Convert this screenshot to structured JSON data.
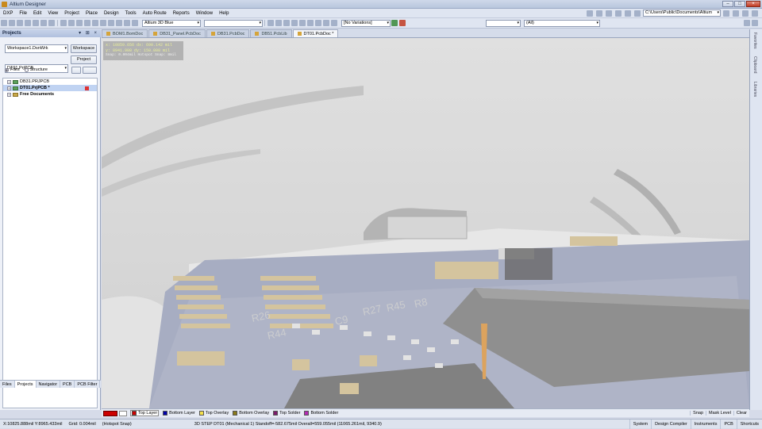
{
  "title": "Altium Designer",
  "menu": [
    "DXP",
    "File",
    "Edit",
    "View",
    "Project",
    "Place",
    "Design",
    "Tools",
    "Auto Route",
    "Reports",
    "Window",
    "Help"
  ],
  "toolbar": {
    "view_config": "Altium 3D Blue",
    "variations": "[No Variations]",
    "path": "C:\\Users\\Public\\Documents\\Altium",
    "filter": "(All)"
  },
  "panel": {
    "title": "Projects",
    "controls": "▾ ⊞ ×",
    "workspace_value": "Workspace1.DsnWrk",
    "workspace_button": "Workspace",
    "project_value": "DT01.PrjPCB",
    "project_button": "Project",
    "radio_files": "Files",
    "radio_structure": "Structure",
    "tree": [
      {
        "label": "DB31.PRJPCB",
        "icon": "project-icon",
        "selected": false
      },
      {
        "label": "DT01.PrjPCB *",
        "icon": "project-icon",
        "selected": true
      },
      {
        "label": "Free Documents",
        "icon": "folder-icon",
        "selected": false
      }
    ],
    "tabs": [
      "Files",
      "Projects",
      "Navigator",
      "PCB",
      "PCB Filter"
    ],
    "active_tab": "Projects"
  },
  "doc_tabs": [
    {
      "label": "BOM1.BomDoc",
      "active": false
    },
    {
      "label": "DB31_Panel.PcbDoc",
      "active": false
    },
    {
      "label": "DB31.PcbDoc",
      "active": false
    },
    {
      "label": "DB51.PcbLib",
      "active": false
    },
    {
      "label": "DT01.PcbDoc *",
      "active": true
    }
  ],
  "coords": {
    "line1": "x: 10859.656   dx: 690.142 mil",
    "line2": "y:  8941.900   dy:  150.000 mil",
    "snap": "Snap: 0.004mil Hotspot Snap: 8mil"
  },
  "right_tabs": [
    "Favorites",
    "Clipboard",
    "Libraries"
  ],
  "pcb_labels": [
    "R26",
    "R44",
    "C9",
    "R27",
    "R45",
    "R8"
  ],
  "layers": [
    {
      "name": "Top Layer",
      "color": "#cc0000",
      "active": true
    },
    {
      "name": "Bottom Layer",
      "color": "#0000aa",
      "active": false
    },
    {
      "name": "Top Overlay",
      "color": "#f5e04a",
      "active": false
    },
    {
      "name": "Bottom Overlay",
      "color": "#8a7a1a",
      "active": false
    },
    {
      "name": "Top Solder",
      "color": "#7a1a6a",
      "active": false
    },
    {
      "name": "Bottom Solder",
      "color": "#b42ab4",
      "active": false
    }
  ],
  "layer_controls": [
    "Snap",
    "Mask Level",
    "Clear"
  ],
  "status": {
    "cursor": "X:10825.888mil Y:8965.433mil",
    "grid": "Grid: 0.004mil",
    "snap": "(Hotspot Snap)",
    "step": "3D STEP DT01 (Mechanical 1)  Standoff=-582.675mil  Overall=559.055mil  (11065.261mil, 9340.9)",
    "buttons": [
      "System",
      "Design Compiler",
      "Instruments",
      "PCB",
      "Shortcuts"
    ]
  }
}
